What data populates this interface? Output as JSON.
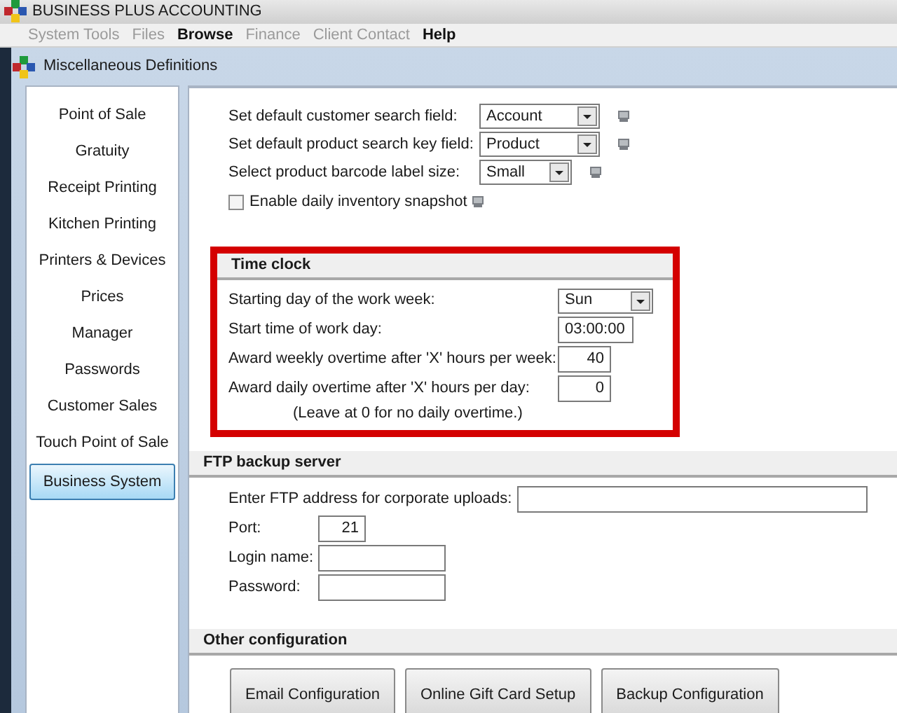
{
  "window": {
    "title": "BUSINESS PLUS ACCOUNTING"
  },
  "menu": [
    {
      "label": "System Tools",
      "disabled": true
    },
    {
      "label": "Files",
      "disabled": true
    },
    {
      "label": "Browse",
      "disabled": false
    },
    {
      "label": "Finance",
      "disabled": true
    },
    {
      "label": "Client Contact",
      "disabled": true
    },
    {
      "label": "Help",
      "disabled": false
    }
  ],
  "subwindow": {
    "title": "Miscellaneous Definitions"
  },
  "sidebar": {
    "items": [
      {
        "label": "Point of Sale",
        "selected": false
      },
      {
        "label": "Gratuity",
        "selected": false
      },
      {
        "label": "Receipt Printing",
        "selected": false
      },
      {
        "label": "Kitchen Printing",
        "selected": false
      },
      {
        "label": "Printers & Devices",
        "selected": false
      },
      {
        "label": "Prices",
        "selected": false
      },
      {
        "label": "Manager",
        "selected": false
      },
      {
        "label": "Passwords",
        "selected": false
      },
      {
        "label": "Customer Sales",
        "selected": false
      },
      {
        "label": "Touch Point of Sale",
        "selected": false
      },
      {
        "label": "Business System",
        "selected": true
      }
    ]
  },
  "general": [
    {
      "kind": "select",
      "label": "Set default customer search field:",
      "value": "Account"
    },
    {
      "kind": "select",
      "label": "Set default product search key field:",
      "value": "Product"
    },
    {
      "kind": "select",
      "label": "Select product barcode label size:",
      "value": "Small"
    },
    {
      "kind": "checkbox",
      "label": "Enable daily inventory snapshot",
      "checked": false
    }
  ],
  "time_clock": {
    "title": "Time clock",
    "highlighted": true,
    "fields": [
      {
        "kind": "select",
        "label": "Starting day of the work week:",
        "value": "Sun"
      },
      {
        "kind": "text",
        "label": "Start time of work day:",
        "value": "03:00:00"
      },
      {
        "kind": "number",
        "label": "Award weekly overtime after 'X' hours per week:",
        "value": "40"
      },
      {
        "kind": "number",
        "label": "Award daily overtime after 'X' hours per day:",
        "value": "0"
      }
    ],
    "note": "(Leave at 0 for no daily overtime.)"
  },
  "ftp": {
    "title": "FTP backup server",
    "fields": [
      {
        "kind": "wide",
        "label": "Enter FTP address for corporate uploads:"
      },
      {
        "kind": "number",
        "label": "Port:",
        "value": "21"
      },
      {
        "kind": "text",
        "label": "Login name:"
      },
      {
        "kind": "text",
        "label": "Password:"
      }
    ]
  },
  "other": {
    "title": "Other configuration",
    "buttons": [
      "Email Configuration",
      "Online Gift Card Setup",
      "Backup Configuration"
    ]
  }
}
